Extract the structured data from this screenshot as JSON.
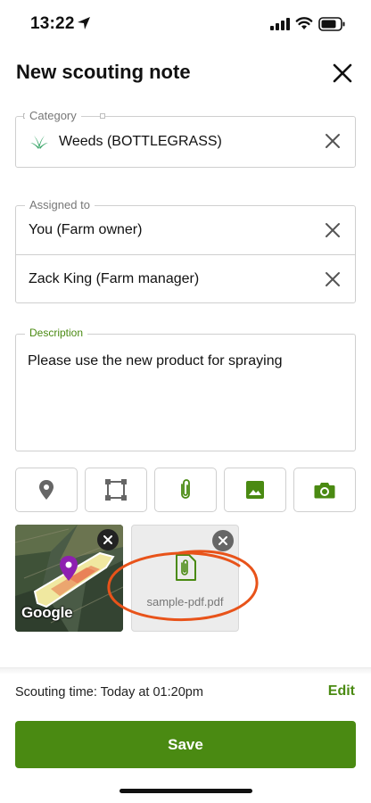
{
  "status_bar": {
    "time": "13:22"
  },
  "header": {
    "title": "New scouting note"
  },
  "category": {
    "legend": "Category",
    "value": "Weeds (BOTTLEGRASS)",
    "icon": "grass-icon"
  },
  "assigned": {
    "legend": "Assigned to",
    "people": [
      "You (Farm owner)",
      "Zack King (Farm manager)"
    ]
  },
  "description": {
    "legend": "Description",
    "value": "Please use the new product for spraying"
  },
  "toolbar": {
    "icons": [
      "location-pin-icon",
      "area-select-icon",
      "paperclip-icon",
      "image-icon",
      "camera-icon"
    ]
  },
  "attachments": {
    "map_attribution": "Google",
    "pdf_filename": "sample-pdf.pdf"
  },
  "footer": {
    "scouting_time": "Scouting time: Today at 01:20pm",
    "edit_label": "Edit",
    "save_label": "Save"
  },
  "colors": {
    "brand_green": "#4a8a12",
    "annotation_orange": "#e8531a",
    "map_pin_purple": "#8e1fb0"
  }
}
